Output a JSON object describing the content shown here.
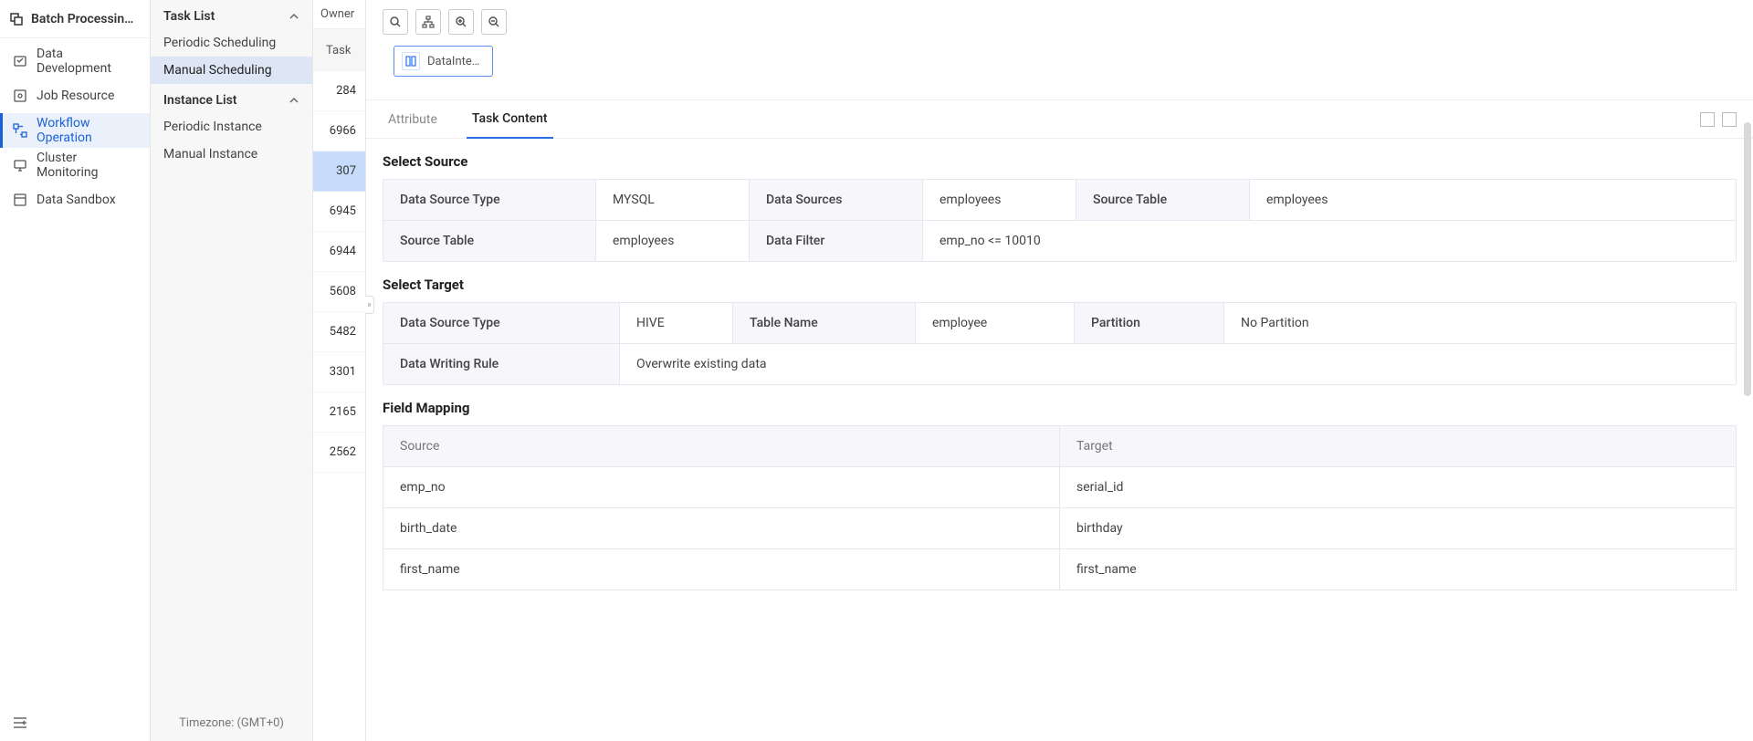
{
  "sidebar1": {
    "title": "Batch Processing…",
    "items": [
      {
        "label": "Data Development",
        "icon": "data-dev-icon"
      },
      {
        "label": "Job Resource",
        "icon": "job-resource-icon"
      },
      {
        "label": "Workflow Operation",
        "icon": "workflow-icon"
      },
      {
        "label": "Cluster Monitoring",
        "icon": "monitor-icon"
      },
      {
        "label": "Data Sandbox",
        "icon": "sandbox-icon"
      }
    ],
    "footer_icon": "collapse-icon"
  },
  "sidebar2": {
    "sections": [
      {
        "header": "Task List",
        "items": [
          "Periodic Scheduling",
          "Manual Scheduling"
        ]
      },
      {
        "header": "Instance List",
        "items": [
          "Periodic Instance",
          "Manual Instance"
        ]
      }
    ],
    "active": "Manual Scheduling",
    "timezone": "Timezone: (GMT+0)"
  },
  "taskcol": {
    "owner": "Owner",
    "header": "Task",
    "rows": [
      "284",
      "6966",
      "307",
      "6945",
      "6944",
      "5608",
      "5482",
      "3301",
      "2165",
      "2562"
    ],
    "active": "307"
  },
  "canvas": {
    "tools": [
      "search",
      "schema",
      "zoom-in",
      "zoom-out"
    ],
    "node_label": "DataInte…"
  },
  "tabs": {
    "attribute": "Attribute",
    "task_content": "Task Content"
  },
  "section_source_title": "Select Source",
  "source": {
    "data_source_type_label": "Data Source Type",
    "data_source_type_value": "MYSQL",
    "data_sources_label": "Data Sources",
    "data_sources_value": "employees",
    "source_table_label": "Source Table",
    "source_table_value": "employees",
    "source_table_label2": "Source Table",
    "source_table_value2": "employees",
    "data_filter_label": "Data Filter",
    "data_filter_value": "emp_no <= 10010"
  },
  "section_target_title": "Select Target",
  "target": {
    "data_source_type_label": "Data Source Type",
    "data_source_type_value": "HIVE",
    "table_name_label": "Table Name",
    "table_name_value": "employee",
    "partition_label": "Partition",
    "partition_value": "No Partition",
    "writing_rule_label": "Data Writing Rule",
    "writing_rule_value": "Overwrite existing data"
  },
  "section_mapping_title": "Field Mapping",
  "mapping": {
    "head_source": "Source",
    "head_target": "Target",
    "rows": [
      {
        "source": "emp_no",
        "target": "serial_id"
      },
      {
        "source": "birth_date",
        "target": "birthday"
      },
      {
        "source": "first_name",
        "target": "first_name"
      }
    ]
  }
}
